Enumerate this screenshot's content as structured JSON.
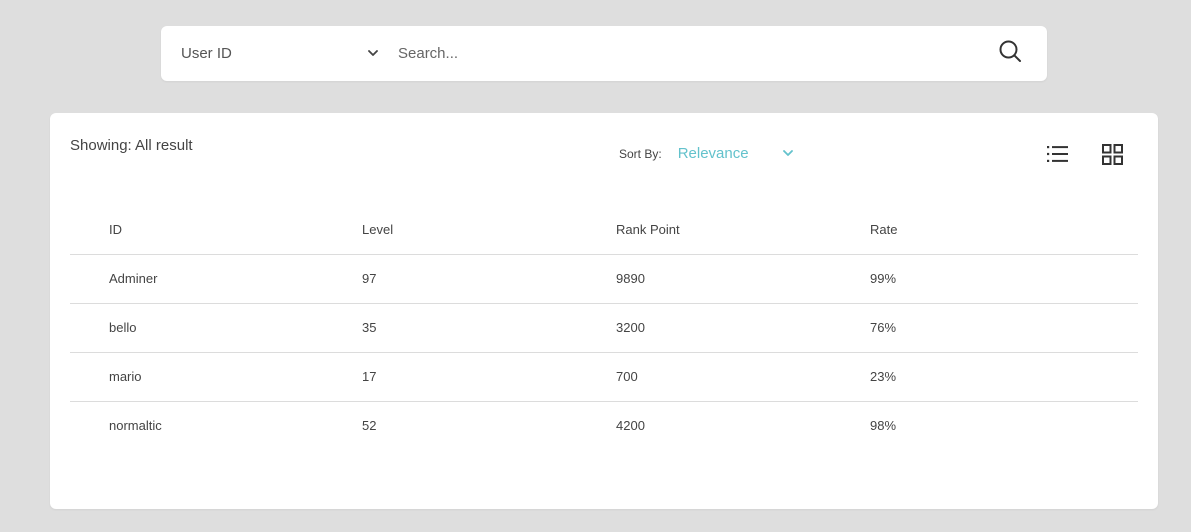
{
  "search": {
    "field_select": "User ID",
    "placeholder": "Search..."
  },
  "results": {
    "showing_text": "Showing: All result",
    "sort_label": "Sort By:",
    "sort_value": "Relevance"
  },
  "table": {
    "headers": [
      "ID",
      "Level",
      "Rank Point",
      "Rate"
    ],
    "rows": [
      [
        "Adminer",
        "97",
        "9890",
        "99%"
      ],
      [
        "bello",
        "35",
        "3200",
        "76%"
      ],
      [
        "mario",
        "17",
        "700",
        "23%"
      ],
      [
        "normaltic",
        "52",
        "4200",
        "98%"
      ]
    ]
  },
  "colors": {
    "accent": "#63c2cc",
    "background": "#dedede"
  },
  "icons": {
    "search": "search-icon",
    "select_chevron": "chevron-down-icon",
    "list_view": "list-view-icon",
    "grid_view": "grid-view-icon"
  }
}
